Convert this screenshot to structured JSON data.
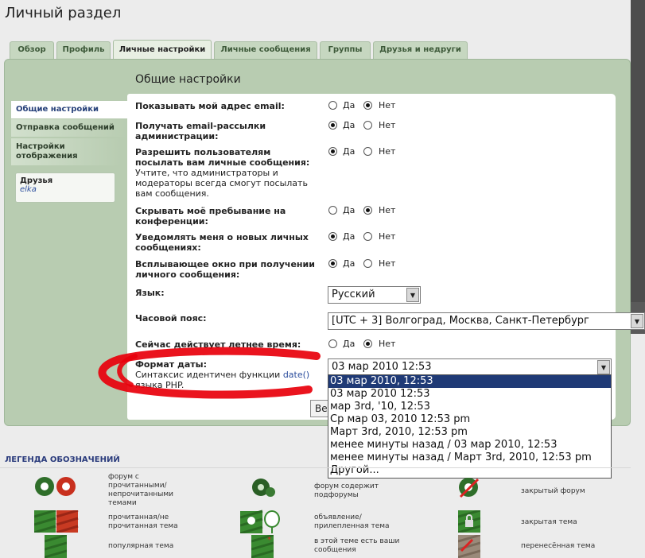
{
  "page": {
    "title": "Личный раздел"
  },
  "tabs": [
    {
      "label": "Обзор"
    },
    {
      "label": "Профиль"
    },
    {
      "label": "Личные настройки",
      "active": true
    },
    {
      "label": "Личные сообщения"
    },
    {
      "label": "Группы"
    },
    {
      "label": "Друзья и недруги"
    }
  ],
  "sidebar": {
    "items": [
      {
        "label": "Общие настройки",
        "active": true
      },
      {
        "label": "Отправка сообщений"
      },
      {
        "label": "Настройки отображения"
      }
    ],
    "friends": {
      "title": "Друзья",
      "name": "elka"
    }
  },
  "section": {
    "title": "Общие настройки"
  },
  "options": {
    "yes": "Да",
    "no": "Нет"
  },
  "settings": {
    "show_email": {
      "label": "Показывать мой адрес email:",
      "value": "no"
    },
    "admin_mail": {
      "label": "Получать email-рассылки администрации:",
      "value": "yes"
    },
    "allow_pm": {
      "label": "Разрешить пользователям посылать вам личные сообщения:",
      "hint": "Учтите, что администраторы и модераторы всегда смогут посылать вам сообщения.",
      "value": "yes"
    },
    "hide_online": {
      "label": "Скрывать моё пребывание на конференции:",
      "value": "no"
    },
    "notify_pm": {
      "label": "Уведомлять меня о новых личных сообщениях:",
      "value": "yes"
    },
    "popup_pm": {
      "label": "Всплывающее окно при получении личного сообщения:",
      "value": "yes"
    },
    "language": {
      "label": "Язык:",
      "value": "Русский"
    },
    "timezone": {
      "label": "Часовой пояс:",
      "value": "[UTC + 3] Волгоград, Москва, Санкт-Петербург"
    },
    "dst": {
      "label": "Сейчас действует летнее время:",
      "value": "no"
    },
    "date_format": {
      "label": "Формат даты:",
      "hint_pre": "Синтаксис идентичен функции",
      "hint_link": "date()",
      "hint_post": "языка PHP.",
      "value": "03 мар 2010 12:53",
      "options": [
        "03 мар 2010, 12:53",
        "03 мар 2010 12:53",
        "мар 3rd, '10, 12:53",
        "Ср мар 03, 2010 12:53 pm",
        "Март 3rd, 2010, 12:53 pm",
        "менее минуты назад / 03 мар 2010, 12:53",
        "менее минуты назад / Март 3rd, 2010, 12:53 pm",
        "Другой..."
      ],
      "highlighted_index": 0
    }
  },
  "submit": {
    "label": "Ве"
  },
  "legend": {
    "title": "ЛЕГЕНДА ОБОЗНАЧЕНИЙ",
    "items": [
      {
        "text": "форум с прочитанными/ непрочитанными темами",
        "icon": "forum-read-unread-icon"
      },
      {
        "text": "форум содержит подфорумы",
        "icon": "forum-subforums-icon"
      },
      {
        "text": "закрытый форум",
        "icon": "forum-locked-icon"
      },
      {
        "text": "прочитанная/не прочитанная тема",
        "icon": "topic-read-unread-icon"
      },
      {
        "text": "объявление/ прилепленная тема",
        "icon": "announcement-sticky-icon"
      },
      {
        "text": "закрытая тема",
        "icon": "topic-locked-icon"
      },
      {
        "text": "популярная тема",
        "icon": "topic-hot-icon"
      },
      {
        "text": "в этой теме есть ваши сообщения",
        "icon": "topic-mine-icon"
      },
      {
        "text": "перенесённая тема",
        "icon": "topic-moved-icon"
      }
    ]
  },
  "colors": {
    "panel_green": "#b8ccb1",
    "tab_green": "#c6d7c0",
    "highlight": "#1f3a76",
    "marker_red": "#e8000b"
  }
}
